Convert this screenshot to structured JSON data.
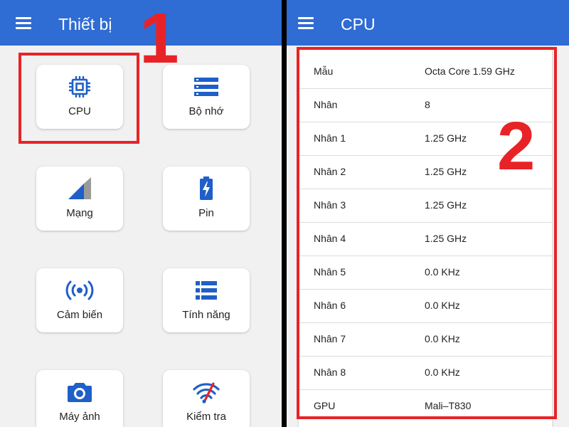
{
  "left_screen": {
    "title": "Thiết bị",
    "tiles": [
      {
        "label": "CPU",
        "icon": "cpu-icon"
      },
      {
        "label": "Bộ nhớ",
        "icon": "memory-icon"
      },
      {
        "label": "Mạng",
        "icon": "signal-icon"
      },
      {
        "label": "Pin",
        "icon": "battery-icon"
      },
      {
        "label": "Cảm biến",
        "icon": "sensor-icon"
      },
      {
        "label": "Tính năng",
        "icon": "features-list-icon"
      },
      {
        "label": "Máy ảnh",
        "icon": "camera-icon"
      },
      {
        "label": "Kiểm tra",
        "icon": "wifi-check-icon"
      }
    ],
    "step_label": "1"
  },
  "right_screen": {
    "title": "CPU",
    "rows": [
      {
        "key": "Mẫu",
        "value": "Octa Core 1.59 GHz"
      },
      {
        "key": "Nhân",
        "value": "8"
      },
      {
        "key": "Nhân 1",
        "value": "1.25 GHz"
      },
      {
        "key": "Nhân 2",
        "value": "1.25 GHz"
      },
      {
        "key": "Nhân 3",
        "value": "1.25 GHz"
      },
      {
        "key": "Nhân 4",
        "value": "1.25 GHz"
      },
      {
        "key": "Nhân 5",
        "value": "0.0 KHz"
      },
      {
        "key": "Nhân 6",
        "value": "0.0 KHz"
      },
      {
        "key": "Nhân 7",
        "value": "0.0 KHz"
      },
      {
        "key": "Nhân 8",
        "value": "0.0 KHz"
      },
      {
        "key": "GPU",
        "value": "Mali–T830"
      }
    ],
    "step_label": "2"
  },
  "colors": {
    "appbar": "#2f6cd3",
    "icon": "#1f5fc7",
    "highlight": "#e82327",
    "background": "#f1f1f1"
  }
}
